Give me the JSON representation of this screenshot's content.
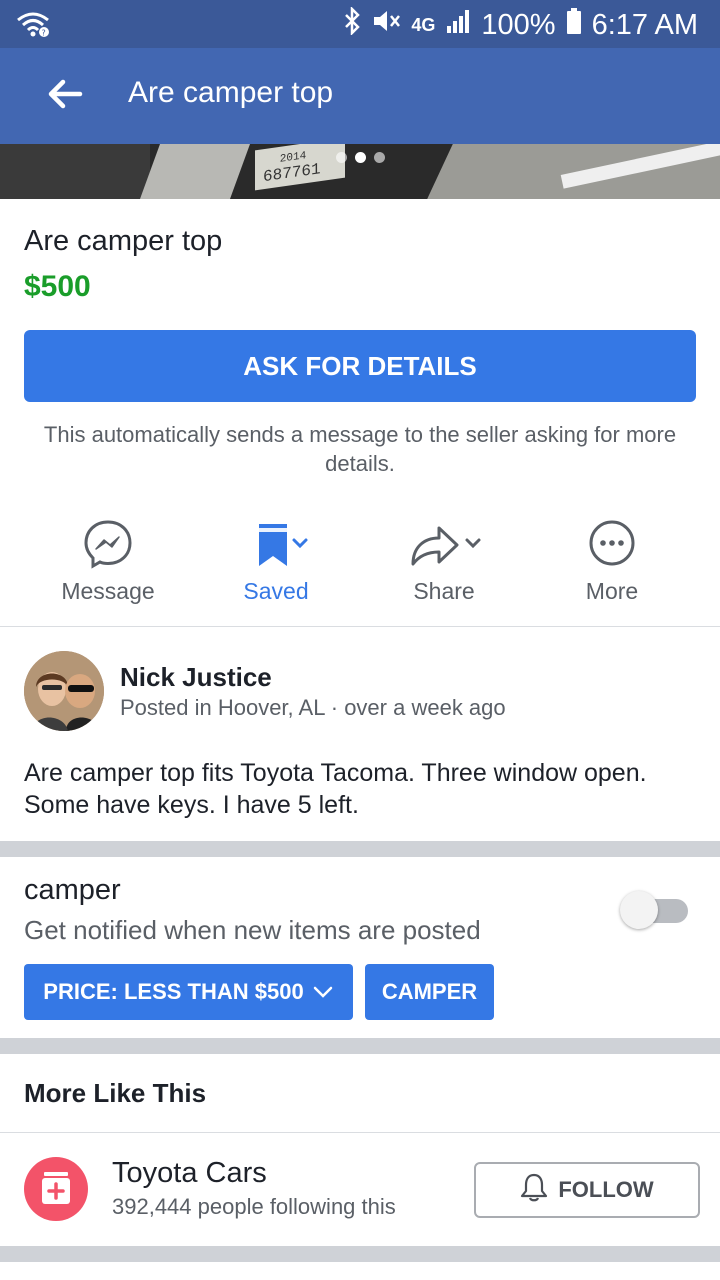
{
  "status_bar": {
    "battery": "100%",
    "time": "6:17 AM",
    "network": "4G"
  },
  "app_bar": {
    "title": "Are camper top"
  },
  "photo": {
    "plate_text": "687761",
    "plate_year": "2014",
    "page_count": 3,
    "current_page": 2
  },
  "listing": {
    "title": "Are camper top",
    "price": "$500",
    "ask_button": "ASK FOR DETAILS",
    "ask_note": "This automatically sends a message to the seller asking for more details."
  },
  "actions": [
    {
      "label": "Message",
      "icon": "messenger-icon"
    },
    {
      "label": "Saved",
      "icon": "bookmark-icon"
    },
    {
      "label": "Share",
      "icon": "share-icon"
    },
    {
      "label": "More",
      "icon": "more-icon"
    }
  ],
  "seller": {
    "name": "Nick Justice",
    "meta": "Posted in Hoover, AL · over a week ago",
    "description": "Are camper top fits Toyota Tacoma. Three window open. Some have keys.  I have 5 left."
  },
  "saved_search": {
    "title": "camper",
    "subtitle": "Get notified when new items are posted",
    "toggle_on": false,
    "chips": [
      {
        "label": "PRICE: LESS THAN $500"
      },
      {
        "label": "CAMPER"
      }
    ]
  },
  "more_like_this": {
    "heading": "More Like This",
    "category": "Toyota Cars",
    "followers": "392,444 people following this",
    "follow_label": "FOLLOW"
  },
  "colors": {
    "status_bar": "#3b5998",
    "app_bar": "#4267b2",
    "accent": "#3578e5",
    "price": "#1a9d2a",
    "category_icon": "#f35369"
  }
}
